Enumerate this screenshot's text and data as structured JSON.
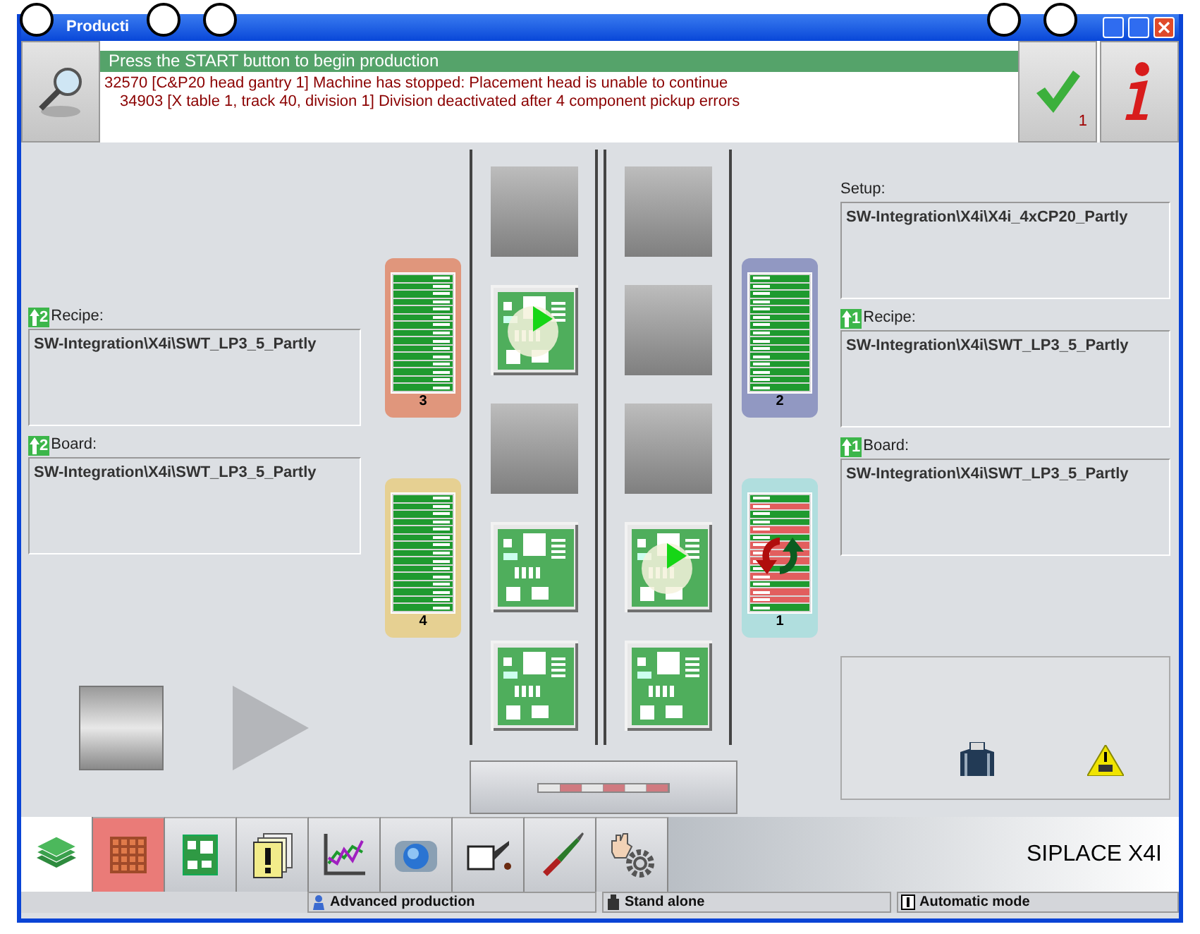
{
  "window": {
    "title": "Producti"
  },
  "header": {
    "banner": "Press the START button to begin production",
    "messages": [
      "32570 [C&P20 head gantry 1] Machine has stopped: Placement head is unable to continue",
      "34903 [X table 1, track 40, division 1] Division deactivated after 4 component pickup errors"
    ],
    "ack_count": "1"
  },
  "left_panel": {
    "fields": [
      {
        "label": "Recipe:",
        "badge": "2",
        "value": "SW-Integration\\X4i\\SWT_LP3_5_Partly"
      },
      {
        "label": "Board:",
        "badge": "2",
        "value": "SW-Integration\\X4i\\SWT_LP3_5_Partly"
      }
    ]
  },
  "left_feeders": [
    {
      "number": "3",
      "color": "#e0967c",
      "kind": "normal"
    },
    {
      "number": "4",
      "color": "#e6d092",
      "kind": "normal"
    }
  ],
  "lanes": [
    {
      "slots": [
        {
          "kind": "empty"
        },
        {
          "kind": "processing"
        },
        {
          "kind": "empty"
        },
        {
          "kind": "board"
        },
        {
          "kind": "board"
        }
      ]
    },
    {
      "slots": [
        {
          "kind": "empty"
        },
        {
          "kind": "empty"
        },
        {
          "kind": "empty"
        },
        {
          "kind": "processing"
        },
        {
          "kind": "board"
        }
      ]
    }
  ],
  "right_feeders": [
    {
      "number": "2",
      "color": "#9198c2",
      "kind": "normal"
    },
    {
      "number": "1",
      "color": "#b0dede",
      "kind": "error"
    }
  ],
  "right_panel": {
    "fields": [
      {
        "label": "Setup:",
        "value": "SW-Integration\\X4i\\X4i_4xCP20_Partly"
      },
      {
        "label": "Recipe:",
        "badge": "1",
        "value": "SW-Integration\\X4i\\SWT_LP3_5_Partly"
      },
      {
        "label": "Board:",
        "badge": "1",
        "value": "SW-Integration\\X4i\\SWT_LP3_5_Partly"
      }
    ]
  },
  "toolbar": {
    "tools": [
      {
        "kind": "boards",
        "selected": true,
        "alert": false
      },
      {
        "kind": "grid",
        "selected": false,
        "alert": true
      },
      {
        "kind": "board",
        "selected": false,
        "alert": false
      },
      {
        "kind": "warning",
        "selected": false,
        "alert": false
      },
      {
        "kind": "chart",
        "selected": false,
        "alert": false
      },
      {
        "kind": "camera",
        "selected": false,
        "alert": false
      },
      {
        "kind": "oil",
        "selected": false,
        "alert": false
      },
      {
        "kind": "tool",
        "selected": false,
        "alert": false
      },
      {
        "kind": "handgear",
        "selected": false,
        "alert": false
      }
    ],
    "brand": "SIPLACE X4I"
  },
  "status_bar": [
    {
      "kind": "user",
      "text": "Advanced production"
    },
    {
      "kind": "machine",
      "text": "Stand alone"
    },
    {
      "kind": "mode",
      "text": "Automatic mode"
    }
  ]
}
